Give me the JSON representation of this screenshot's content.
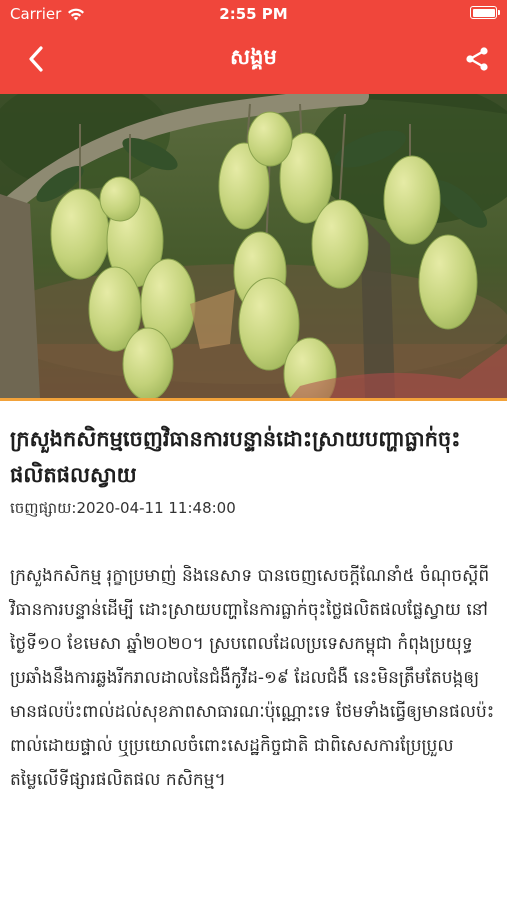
{
  "status_bar": {
    "carrier": "Carrier",
    "time": "2:55 PM"
  },
  "nav": {
    "title": "សង្គម",
    "back_icon": "chevron-left-icon",
    "share_icon": "share-icon"
  },
  "colors": {
    "header_bg": "#f0463b",
    "accent_line": "#f2a23a"
  },
  "article": {
    "image_alt": "mango-tree-photo",
    "headline": "ក្រសួងកសិកម្មចេញវិធានការបន្ទាន់ដោះស្រាយបញ្ហាធ្លាក់ចុះផលិតផលស្វាយ",
    "published_label": "ចេញផ្សាយ:",
    "published_date": "2020-04-11 11:48:00",
    "paragraphs": [
      "ក្រសួងកសិកម្ម រុក្ខាប្រមាញ់ និងនេសាទ បានចេញសេចក្ដីណែនាំ៥ ចំណុចស្ដីពីវិធានការបន្ទាន់ដើម្បី ដោះស្រាយបញ្ហានៃការធ្លាក់ចុះថ្លៃផលិតផលផ្លែស្វាយ នៅថ្ងៃទី១០ ខែមេសា ឆ្នាំ២០២០។ ស្របពេលដែលប្រទេសកម្ពុជា កំពុងប្រយុទ្ធប្រឆាំងនឹងការឆ្លងរីករាលដាលនៃជំងឺកូវីដ-១៩ ដែលជំងឺ នេះមិនត្រឹមតែបង្កឲ្យមានផលប៉ះពាល់ដល់សុខភាពសាធារណៈប៉ុណ្ណោះទេ ថែមទាំងធ្វើឲ្យមានផលប៉ះ ពាល់ដោយផ្ទាល់ ឬប្រយោលចំពោះសេដ្ឋកិច្ចជាតិ ជាពិសេសការប្រែប្រួលតម្លៃលើទីផ្សារផលិតផល កសិកម្ម។"
    ]
  }
}
